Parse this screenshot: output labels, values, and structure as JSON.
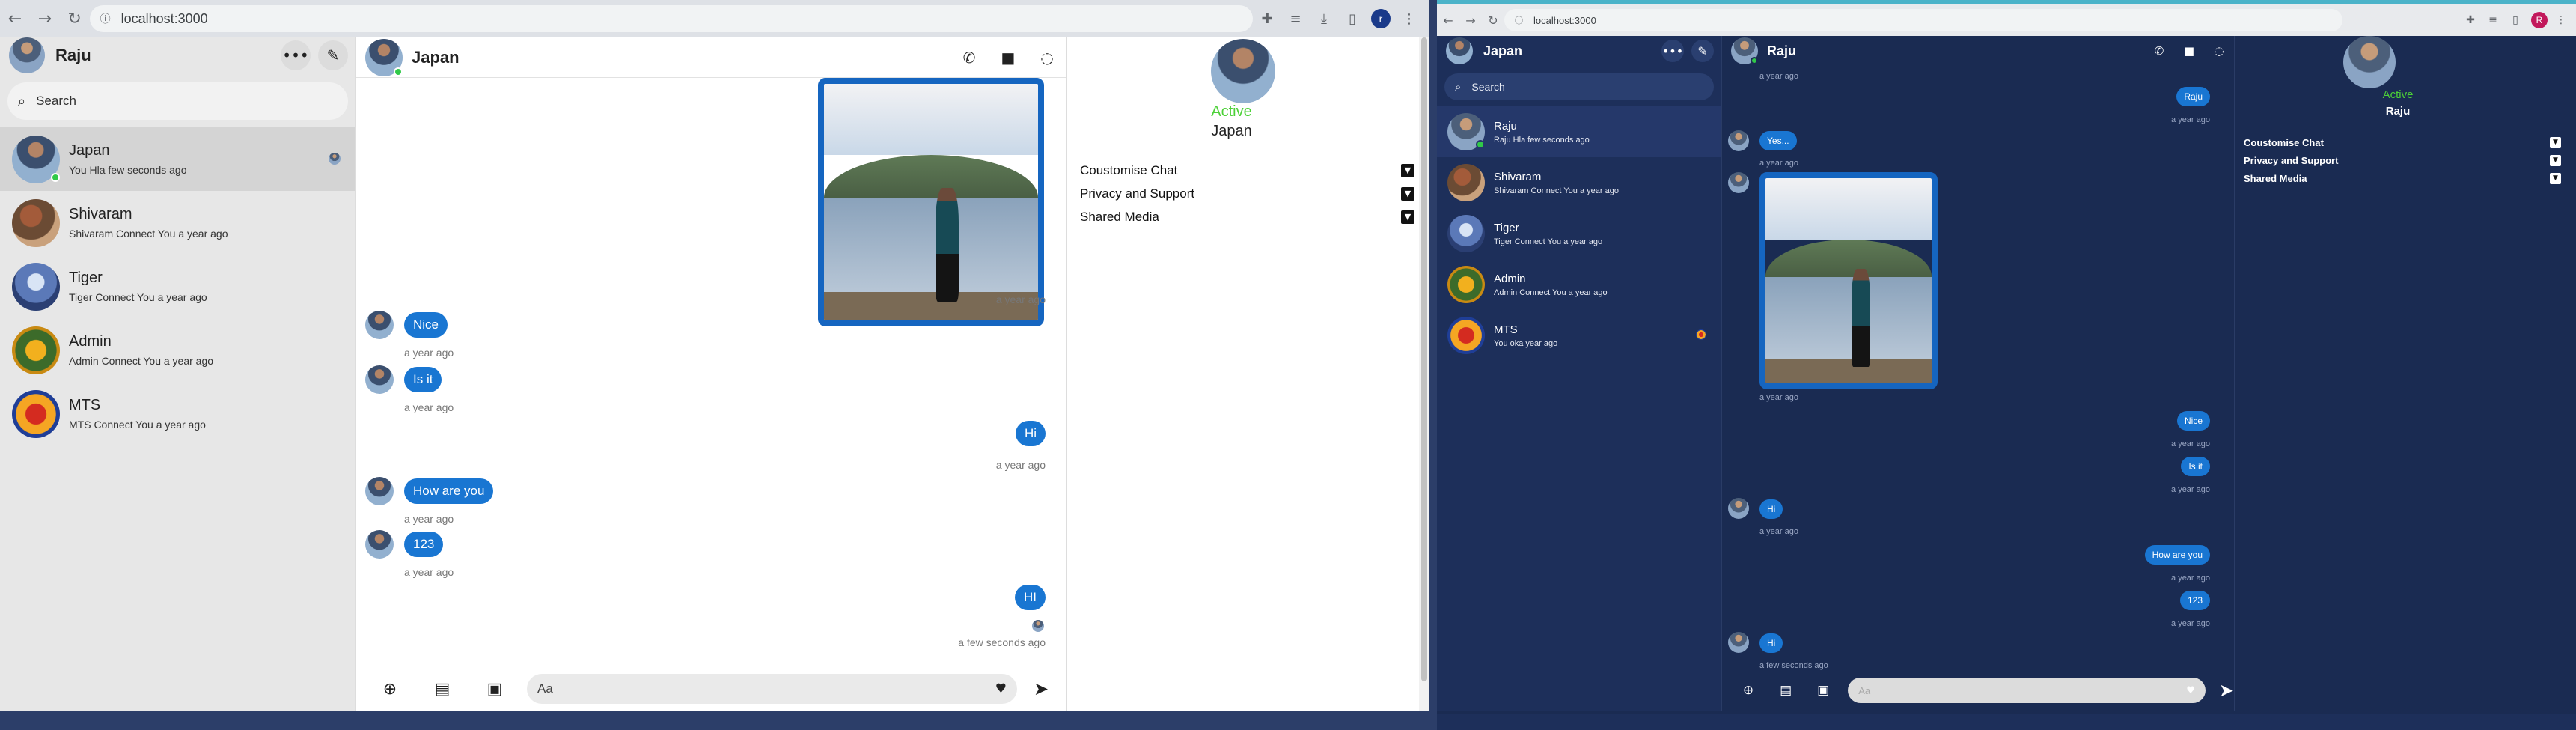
{
  "left": {
    "url": "localhost:3000",
    "profile_initial": "r",
    "sidebar": {
      "title": "Raju",
      "search_placeholder": "Search",
      "conversations": [
        {
          "name": "Japan",
          "preview": "You Hla few seconds ago"
        },
        {
          "name": "Shivaram",
          "preview": "Shivaram Connect You a year ago"
        },
        {
          "name": "Tiger",
          "preview": "Tiger Connect You a year ago"
        },
        {
          "name": "Admin",
          "preview": "Admin Connect You a year ago"
        },
        {
          "name": "MTS",
          "preview": "MTS Connect You a year ago"
        }
      ]
    },
    "chat": {
      "title": "Japan",
      "photo_time": "a year ago",
      "messages": [
        {
          "text": "Nice",
          "time": "a year ago"
        },
        {
          "text": "Is it",
          "time": "a year ago"
        },
        {
          "text": "Hi",
          "time": "a year ago"
        },
        {
          "text": "How are you",
          "time": "a year ago"
        },
        {
          "text": "123",
          "time": "a year ago"
        },
        {
          "text": "HI",
          "time": "a few seconds ago"
        }
      ],
      "composer_placeholder": "Aa"
    },
    "info": {
      "status": "Active",
      "name": "Japan",
      "rows": [
        "Coustomise Chat",
        "Privacy and Support",
        "Shared Media"
      ]
    }
  },
  "right": {
    "url": "localhost:3000",
    "profile_initial": "R",
    "sidebar": {
      "title": "Japan",
      "search_placeholder": "Search",
      "conversations": [
        {
          "name": "Raju",
          "preview": "Raju Hla few seconds ago"
        },
        {
          "name": "Shivaram",
          "preview": "Shivaram Connect You a year ago"
        },
        {
          "name": "Tiger",
          "preview": "Tiger Connect You a year ago"
        },
        {
          "name": "Admin",
          "preview": "Admin Connect You a year ago"
        },
        {
          "name": "MTS",
          "preview": "You oka year ago"
        }
      ]
    },
    "chat": {
      "title": "Raju",
      "top_time": "a year ago",
      "messages": [
        {
          "text": "Raju",
          "time": "a year ago"
        },
        {
          "text": "Yes...",
          "time": "a year ago"
        },
        {
          "text": "",
          "time": "a year ago"
        },
        {
          "text": "Nice",
          "time": "a year ago"
        },
        {
          "text": "Is it",
          "time": "a year ago"
        },
        {
          "text": "Hi",
          "time": "a year ago"
        },
        {
          "text": "How are you",
          "time": "a year ago"
        },
        {
          "text": "123",
          "time": "a year ago"
        },
        {
          "text": "Hi",
          "time": "a few seconds ago"
        }
      ],
      "composer_placeholder": "Aa"
    },
    "info": {
      "status": "Active",
      "name": "Raju",
      "rows": [
        "Coustomise Chat",
        "Privacy and Support",
        "Shared Media"
      ]
    }
  },
  "colors": {
    "bubble": "#1976d2",
    "active_status": "#4cd137",
    "dark_theme_bg": "#1a2b52"
  }
}
